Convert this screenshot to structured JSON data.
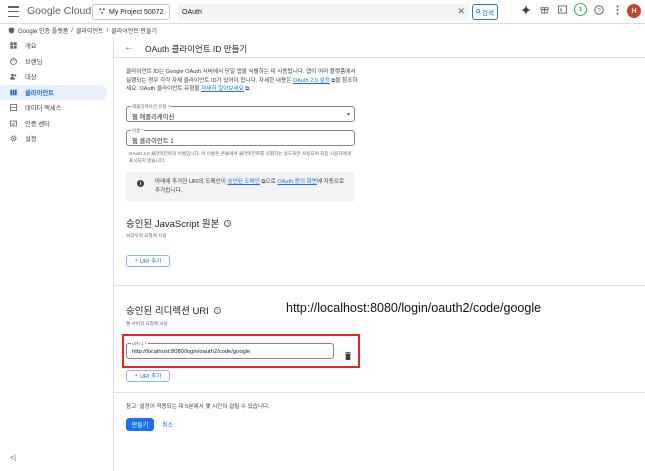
{
  "topbar": {
    "logo_google": "Google",
    "logo_cloud": " Cloud",
    "project": "My Project 50072",
    "search_value": "OAuth",
    "search_label": "검색",
    "notification_count": "1",
    "avatar_letter": "H"
  },
  "breadcrumb": [
    "Google 인증 플랫폼",
    "클라이언트",
    "클라이언트 만들기"
  ],
  "sidebar": {
    "items": [
      {
        "label": "개요",
        "icon": "dashboard-icon"
      },
      {
        "label": "브랜딩",
        "icon": "palette-icon"
      },
      {
        "label": "대상",
        "icon": "people-icon"
      },
      {
        "label": "클라이언트",
        "icon": "key-icon",
        "active": true
      },
      {
        "label": "데이터 액세스",
        "icon": "data-access-icon"
      },
      {
        "label": "인증 센터",
        "icon": "verification-icon"
      },
      {
        "label": "설정",
        "icon": "gear-icon"
      }
    ],
    "collapse_glyph": "<|"
  },
  "header": {
    "title": "OAuth 클라이언트 ID 만들기"
  },
  "intro": {
    "text1": "클라이언트 ID는 Google OAuth 서버에서 단일 앱을 식별하는 데 사용됩니다. 앱이 여러 플랫폼에서 실행되는 경우 각각 자체 클라이언트 ID가 있어야 합니다. 자세한 내용은 ",
    "link1": "OAuth 2.0 설정",
    "text2": "을 참조하세요. OAuth 클라이언트 유형을 ",
    "link2": "자세히 알아보세요",
    "text3": "."
  },
  "app_type": {
    "label": "애플리케이션 유형 *",
    "value": "웹 애플리케이션"
  },
  "name_field": {
    "label": "이름 *",
    "value": "웹 클라이언트 1",
    "help": "OAuth 2.0 클라이언트의 이름입니다. 이 이름은 콘솔에서 클라이언트를 식별하는 용도로만 사용되며 최종 사용자에게 표시되지 않습니다."
  },
  "info_box": {
    "text1": "아래에 추가한 URI의 도메인이 ",
    "link1": "승인된 도메인",
    "text2": "으로 ",
    "link2": "OAuth 동의 화면",
    "text3": "에 자동으로 추가됩니다."
  },
  "js_origins": {
    "title": "승인된 JavaScript 원본",
    "subtitle": "브라우저 요청에 사용",
    "add_label": "URI 추가"
  },
  "redirect_uris": {
    "title": "승인된 리디렉션 URI",
    "subtitle": "웹 서버의 요청에 사용",
    "field_label": "URI 1 *",
    "field_value": "http://localhost:8080/login/oauth2/code/google",
    "add_label": "URI 추가"
  },
  "note": "참고: 설정이 적용되는 데 5분에서 몇 시간이 걸릴 수 있습니다.",
  "actions": {
    "create": "만들기",
    "cancel": "취소"
  },
  "annotation": "http://localhost:8080/login/oauth2/code/google",
  "colors": {
    "accent": "#1a73e8",
    "highlight": "#e8262a",
    "active_bg": "#e8f0fe"
  }
}
